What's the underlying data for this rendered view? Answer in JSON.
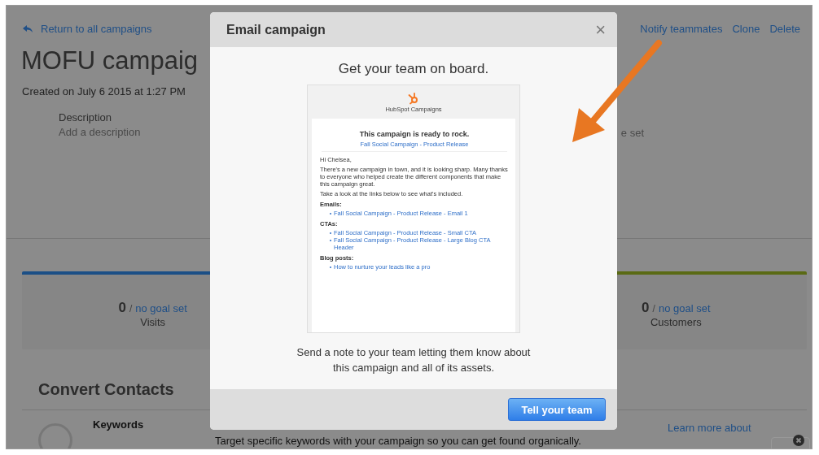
{
  "back_link": {
    "label": "Return to all campaigns"
  },
  "actions": [
    "Notify teammates",
    "Clone",
    "Delete"
  ],
  "campaign": {
    "title": "MOFU campaig",
    "created": "Created on July 6 2015 at 1:27 PM",
    "description_label": "Description",
    "description_prompt": "Add a description",
    "side_text": "e set"
  },
  "stats": [
    {
      "value": "0",
      "separator": "/",
      "goal": "no goal set",
      "label": "Visits",
      "color": "#1b4f86"
    },
    {
      "value": "0",
      "separator": "/",
      "goal": "no goal set",
      "label": "Customers",
      "color": "#5a6a14"
    }
  ],
  "section": {
    "title": "Convert Contacts",
    "items": [
      {
        "name": "Keywords",
        "text": "Target specific keywords with your campaign so you can get found organically.",
        "link": "Learn more about"
      }
    ]
  },
  "modal": {
    "title": "Email campaign",
    "close": "×",
    "heading": "Get your team on board.",
    "preview": {
      "brand": "HubSpot Campaigns",
      "headline": "This campaign is ready to rock.",
      "campaign_link": "Fall Social Campaign - Product Release",
      "greeting": "Hi Chelsea,",
      "paragraphs": [
        "There's a new campaign in town, and it is looking sharp. Many thanks to everyone who helped create the different components that make this campaign great.",
        "Take a look at the links below to see what's included."
      ],
      "groups": [
        {
          "title": "Emails:",
          "links": [
            "Fall Social Campaign - Product Release - Email 1"
          ]
        },
        {
          "title": "CTAs:",
          "links": [
            "Fall Social Campaign - Product Release - Small CTA",
            "Fall Social Campaign - Product Release - Large Blog CTA Header"
          ]
        },
        {
          "title": "Blog posts:",
          "links": [
            "How to nurture your leads like a pro"
          ]
        }
      ]
    },
    "description": "Send a note to your team letting them know about this campaign and all of its assets.",
    "button": "Tell your team"
  }
}
